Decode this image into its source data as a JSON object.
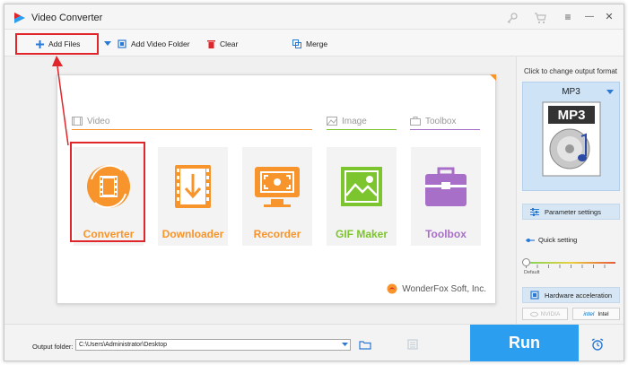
{
  "window": {
    "title": "Video Converter",
    "accent": "#2b9ef0",
    "highlight_color": "#e0262a"
  },
  "titlebar": {
    "icons": [
      "key-icon",
      "cart-icon",
      "menu-icon",
      "minimize-icon",
      "close-icon"
    ],
    "menu_glyph": "≡",
    "minimize_glyph": "—",
    "close_glyph": "✕"
  },
  "toolbar": {
    "add_files_label": "Add Files",
    "add_folder_label": "Add Video Folder",
    "clear_label": "Clear",
    "merge_label": "Merge"
  },
  "sections": {
    "video": "Video",
    "image": "Image",
    "toolbox": "Toolbox"
  },
  "tiles": [
    {
      "label": "Converter",
      "icon": "film-reel-icon",
      "color": "#f7942b"
    },
    {
      "label": "Downloader",
      "icon": "download-icon",
      "color": "#f7942b"
    },
    {
      "label": "Recorder",
      "icon": "screen-record-icon",
      "color": "#f7942b"
    },
    {
      "label": "GIF Maker",
      "icon": "image-icon",
      "color": "#7dc52e"
    },
    {
      "label": "Toolbox",
      "icon": "toolbox-icon",
      "color": "#a86fc9"
    }
  ],
  "brand": "WonderFox Soft, Inc.",
  "right_panel": {
    "caption": "Click to change output format",
    "format": "MP3",
    "format_badge": "MP3",
    "parameter_settings": "Parameter settings",
    "quick_setting": "Quick setting",
    "slider_label": "Default",
    "hardware_acceleration": "Hardware acceleration",
    "nvidia": "NVIDIA",
    "intel": "Intel",
    "intel_logo": "intel"
  },
  "bottom": {
    "output_label": "Output folder:",
    "output_path": "C:\\Users\\Administrator\\Desktop",
    "run_label": "Run"
  }
}
